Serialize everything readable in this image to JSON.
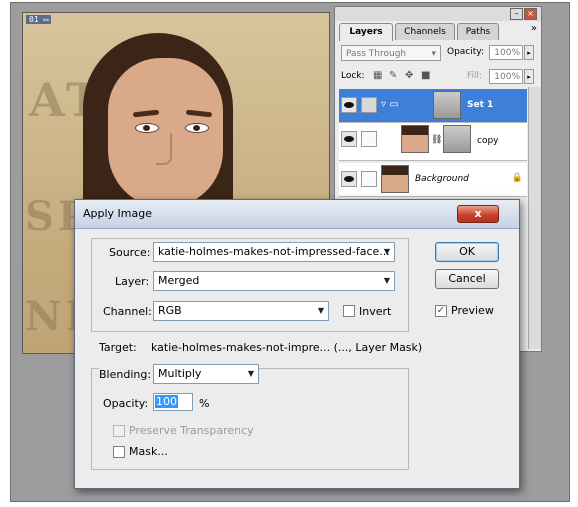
{
  "document": {
    "tab_label": "01"
  },
  "canvas_text": [
    "ATE",
    "SP",
    "NE"
  ],
  "layers_panel": {
    "tabs": [
      "Layers",
      "Channels",
      "Paths"
    ],
    "blend_mode": "Pass Through",
    "opacity_label": "Opacity:",
    "opacity_value": "100%",
    "lock_label": "Lock:",
    "fill_label": "Fill:",
    "fill_value": "100%",
    "layers": [
      {
        "name": "Set 1",
        "selected": true
      },
      {
        "name": "copy",
        "selected": false
      },
      {
        "name": "Background",
        "selected": false
      }
    ]
  },
  "dialog": {
    "title": "Apply Image",
    "close_label": "x",
    "source_label": "Source:",
    "source_value": "katie-holmes-makes-not-impressed-face...",
    "layer_label": "Layer:",
    "layer_value": "Merged",
    "channel_label": "Channel:",
    "channel_value": "RGB",
    "invert_label": "Invert",
    "target_label": "Target:",
    "target_value": "katie-holmes-makes-not-impre... (..., Layer Mask)",
    "blending_label": "Blending:",
    "blending_value": "Multiply",
    "opacity_label": "Opacity:",
    "opacity_value": "100",
    "opacity_unit": "%",
    "preserve_label": "Preserve Transparency",
    "mask_label": "Mask...",
    "ok_label": "OK",
    "cancel_label": "Cancel",
    "preview_label": "Preview",
    "preview_checked": true
  }
}
